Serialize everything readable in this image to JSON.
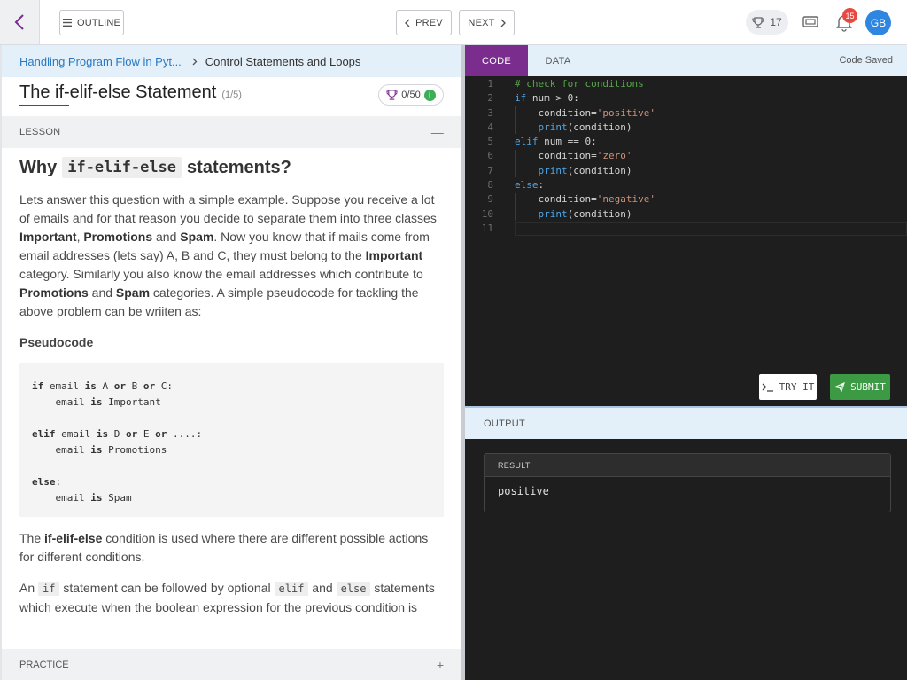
{
  "topbar": {
    "outline_label": "OUTLINE",
    "prev_label": "PREV",
    "next_label": "NEXT",
    "trophy_count": "17",
    "notification_count": "15",
    "avatar_initials": "GB"
  },
  "breadcrumb": {
    "parent": "Handling Program Flow in Pyt...",
    "current": "Control Statements and Loops"
  },
  "lesson": {
    "title": "The if-elif-else Statement",
    "progress": "(1/5)",
    "score": "0/50",
    "info_glyph": "i",
    "section_label": "LESSON",
    "section_toggle": "—",
    "heading_pre": "Why",
    "heading_code": "if-elif-else",
    "heading_post": "statements?",
    "pseudo_heading": "Pseudocode",
    "practice_label": "PRACTICE",
    "practice_toggle": "+"
  },
  "paragraph1": {
    "t1": "Lets answer this question with a simple example. Suppose you receive a lot of emails and for that reason you decide to separate them into three classes ",
    "b1": "Important",
    "t2": ", ",
    "b2": "Promotions",
    "t3": " and ",
    "b3": "Spam",
    "t4": ". Now you know that if mails come from email addresses (lets say) A, B and C, they must belong to the ",
    "b4": "Important",
    "t5": " category. Similarly you also know the email addresses which contribute to ",
    "b5": "Promotions",
    "t6": " and ",
    "b6": "Spam",
    "t7": " categories. A simple pseudocode for tackling the above problem can be wriiten as:"
  },
  "pseudocode": [
    {
      "kw1": "if",
      "r1": " email ",
      "kw2": "is",
      "r2": " A ",
      "kw3": "or",
      "r3": " B ",
      "kw4": "or",
      "r4": " C:"
    },
    {
      "r1": "    email ",
      "kw2": "is",
      "r2": " Important"
    },
    {
      "r1": ""
    },
    {
      "kw1": "elif",
      "r1": " email ",
      "kw2": "is",
      "r2": " D ",
      "kw3": "or",
      "r3": " E ",
      "kw4": "or",
      "r4": " ....:"
    },
    {
      "r1": "    email ",
      "kw2": "is",
      "r2": " Promotions"
    },
    {
      "r1": ""
    },
    {
      "kw1": "else",
      "r1": ":"
    },
    {
      "r1": "    email ",
      "kw2": "is",
      "r2": " Spam"
    }
  ],
  "paragraph2": {
    "t1": "The ",
    "b1": "if-elif-else",
    "t2": " condition is used where there are different possible actions for different conditions."
  },
  "paragraph3": {
    "t1": "An ",
    "c1": "if",
    "t2": " statement can be followed by optional ",
    "c2": "elif",
    "t3": " and ",
    "c3": "else",
    "t4": " statements which execute when the boolean expression for the previous condition is"
  },
  "editor": {
    "tab_code": "CODE",
    "tab_data": "DATA",
    "status": "Code Saved",
    "lines": [
      {
        "n": "1",
        "indent": "",
        "parts": [
          [
            "cm",
            "# check for conditions"
          ]
        ]
      },
      {
        "n": "2",
        "indent": "",
        "parts": [
          [
            "kw",
            "if"
          ],
          [
            "",
            " num > 0:"
          ]
        ]
      },
      {
        "n": "3",
        "indent": "    ",
        "parts": [
          [
            "",
            "condition="
          ],
          [
            "str",
            "'positive'"
          ]
        ]
      },
      {
        "n": "4",
        "indent": "    ",
        "parts": [
          [
            "kw",
            "print"
          ],
          [
            "",
            "(condition)"
          ]
        ]
      },
      {
        "n": "5",
        "indent": "",
        "parts": [
          [
            "kw",
            "elif"
          ],
          [
            "",
            " num == 0:"
          ]
        ]
      },
      {
        "n": "6",
        "indent": "    ",
        "parts": [
          [
            "",
            "condition="
          ],
          [
            "str",
            "'zero'"
          ]
        ]
      },
      {
        "n": "7",
        "indent": "    ",
        "parts": [
          [
            "kw",
            "print"
          ],
          [
            "",
            "(condition)"
          ]
        ]
      },
      {
        "n": "8",
        "indent": "",
        "parts": [
          [
            "kw",
            "else"
          ],
          [
            "",
            ":"
          ]
        ]
      },
      {
        "n": "9",
        "indent": "    ",
        "parts": [
          [
            "",
            "condition="
          ],
          [
            "str",
            "'negative'"
          ]
        ]
      },
      {
        "n": "10",
        "indent": "    ",
        "parts": [
          [
            "kw",
            "print"
          ],
          [
            "",
            "(condition)"
          ]
        ]
      },
      {
        "n": "11",
        "indent": "",
        "parts": []
      }
    ],
    "tryit_label": "TRY IT",
    "submit_label": "SUBMIT"
  },
  "output": {
    "label": "OUTPUT",
    "result_label": "RESULT",
    "result_value": "positive"
  },
  "colors": {
    "accent_purple": "#7b2d8e",
    "link_blue": "#2b78c2",
    "submit_green": "#3c9a44",
    "badge_red": "#e8493f",
    "avatar_blue": "#2f86e0"
  }
}
